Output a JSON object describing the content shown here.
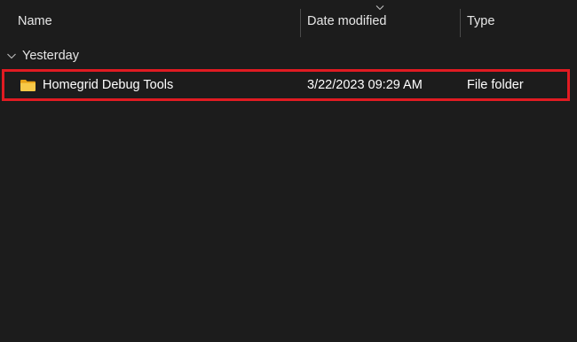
{
  "columns": {
    "name": "Name",
    "date_modified": "Date modified",
    "type": "Type"
  },
  "sort": {
    "column": "date_modified",
    "direction": "descending"
  },
  "groups": [
    {
      "label": "Yesterday",
      "expanded": true,
      "items": [
        {
          "name": "Homegrid Debug Tools",
          "date_modified": "3/22/2023 09:29 AM",
          "type": "File folder",
          "icon": "folder-icon",
          "highlighted": true
        }
      ]
    }
  ],
  "colors": {
    "background": "#1c1c1c",
    "highlight_border": "#e11b22",
    "folder": "#f4c542"
  }
}
